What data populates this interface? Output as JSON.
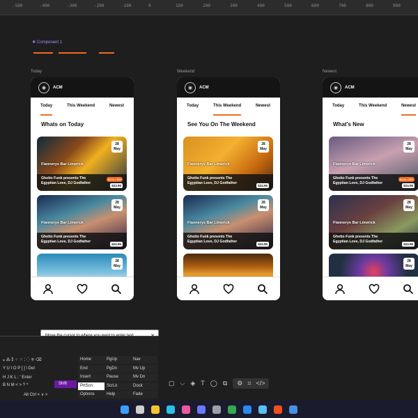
{
  "ruler": {
    "ticks": [
      "-500",
      "-400",
      "-300",
      "-200",
      "-100",
      "0",
      "100",
      "200",
      "300",
      "400",
      "500",
      "600",
      "700",
      "800",
      "900",
      "1000"
    ]
  },
  "canvas": {
    "component_label": "❖ Component 1",
    "frames": [
      {
        "label": "Today",
        "brand": "ACM",
        "tabs": [
          "Today",
          "This Weekend",
          "Newest"
        ],
        "active_tab": 0,
        "section_title": "Whats on Today",
        "cards": [
          {
            "venue": "Flannerys Bar Limerick",
            "day": "28",
            "month": "May",
            "title_line1": "Ghetto Funk presents The",
            "title_line2": "Egyptian Love, DJ Godfather",
            "price": "$24.95",
            "book": "Book • $80"
          },
          {
            "venue": "Flannerys Bar Limerick",
            "day": "28",
            "month": "May",
            "title_line1": "Ghetto Funk presents The",
            "title_line2": "Egyptian Love, DJ Godfather",
            "price": "$24.95",
            "book": ""
          },
          {
            "venue": "",
            "day": "28",
            "month": "May",
            "title_line1": "",
            "title_line2": "",
            "price": "",
            "book": ""
          }
        ]
      },
      {
        "label": "Weekend",
        "brand": "ACM",
        "tabs": [
          "Today",
          "This Weekend",
          "Newest"
        ],
        "active_tab": 1,
        "section_title": "See You On The Weekend",
        "cards": [
          {
            "venue": "Flannerys Bar Limerick",
            "day": "28",
            "month": "May",
            "title_line1": "Ghetto Funk presents The",
            "title_line2": "Egyptian Love, DJ Godfather",
            "price": "$24.95",
            "book": ""
          },
          {
            "venue": "Flannerys Bar Limerick",
            "day": "28",
            "month": "May",
            "title_line1": "Ghetto Funk presents The",
            "title_line2": "Egyptian Love, DJ Godfather",
            "price": "$24.95",
            "book": ""
          },
          {
            "venue": "",
            "day": "",
            "month": "",
            "title_line1": "",
            "title_line2": "",
            "price": "",
            "book": ""
          }
        ]
      },
      {
        "label": "Newest",
        "brand": "ACM",
        "tabs": [
          "Today",
          "This Weekend",
          "Newest"
        ],
        "active_tab": 2,
        "section_title": "What's New",
        "cards": [
          {
            "venue": "Flannerys Bar Limerick",
            "day": "28",
            "month": "May",
            "title_line1": "Ghetto Funk presents The",
            "title_line2": "Egyptian Love, DJ Godfather",
            "price": "$24.95",
            "book": "Book • $80"
          },
          {
            "venue": "Flannerys Bar Limerick",
            "day": "28",
            "month": "May",
            "title_line1": "Ghetto Funk presents The",
            "title_line2": "Egyptian Love, DJ Godfather",
            "price": "$24.95",
            "book": ""
          },
          {
            "venue": "",
            "day": "28",
            "month": "May",
            "title_line1": "",
            "title_line2": "",
            "price": "",
            "book": ""
          }
        ]
      }
    ]
  },
  "keyboard": {
    "tooltip": "Move the cursor to where you want to enter text.",
    "row1": "⁎  ⁂  ⁑  ⁘  ⁙  ⁚  ⁛  ⁜  ⌫",
    "row2": "Y  U  I  O  P  [  ]  \\  Del",
    "row3": "H  J  K  L  ;  '    Enter",
    "row4": "B  N  M  <  >  ?   ^",
    "row5": "Alt  Ctrl  <  ∨  >",
    "shift": "Shift",
    "keys_col1": [
      "Home",
      "End",
      "Insert",
      "PrtScn",
      "Options"
    ],
    "keys_col2": [
      "PgUp",
      "PgDn",
      "Pause",
      "ScrLk",
      "Help"
    ],
    "keys_col3": [
      "Nav",
      "Mv Up",
      "Mv Dn",
      "Dock",
      "Fade"
    ]
  },
  "toolbar": {
    "tools": [
      "▢",
      "⌵",
      "◈",
      "T",
      "◯",
      "⧉",
      "⚙",
      "⌗",
      "</>"
    ]
  },
  "taskbar": {
    "icons": [
      "windows-icon",
      "search-icon",
      "folder-icon",
      "edge-icon",
      "photos-icon",
      "store-icon",
      "settings-icon",
      "chrome-icon",
      "vscode-icon",
      "files-icon",
      "figma-icon",
      "app-icon"
    ]
  }
}
